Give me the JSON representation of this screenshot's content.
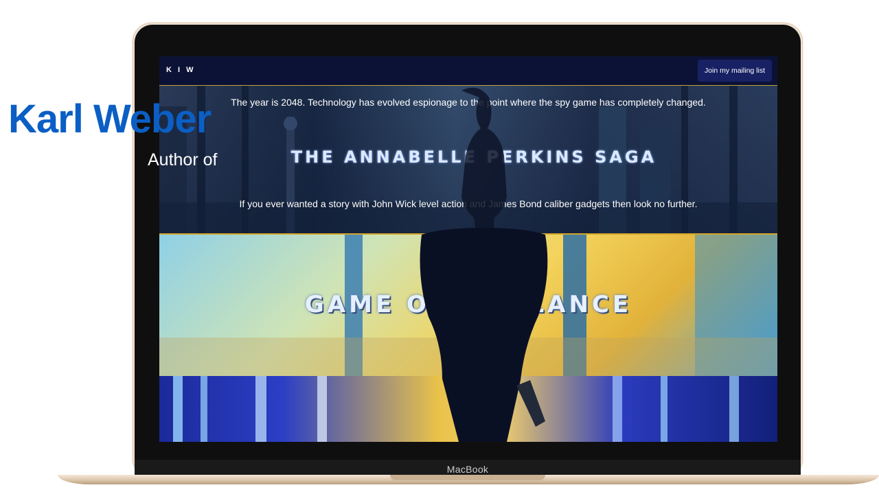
{
  "overlay": {
    "author_name": "Karl Weber",
    "author_of": "Author of"
  },
  "navbar": {
    "brand": "K I W",
    "mailing_button": "Join my mailing list"
  },
  "hero": {
    "intro": "The year is 2048. Technology has evolved espionage to the point where the spy game has completely changed.",
    "saga_title": "THE ANNABELLE PERKINS SAGA",
    "pitch": "If you ever wanted a story with John Wick level action and James Bond caliber gadgets then look no further."
  },
  "books": [
    {
      "title": "GAME OF VIGILANCE"
    },
    {
      "title": ""
    }
  ],
  "device": {
    "label": "MacBook"
  },
  "colors": {
    "author_name": "#0b5fc4",
    "navbar": "#0b1236",
    "button": "#172163",
    "accent_border": "#d4a52a"
  }
}
